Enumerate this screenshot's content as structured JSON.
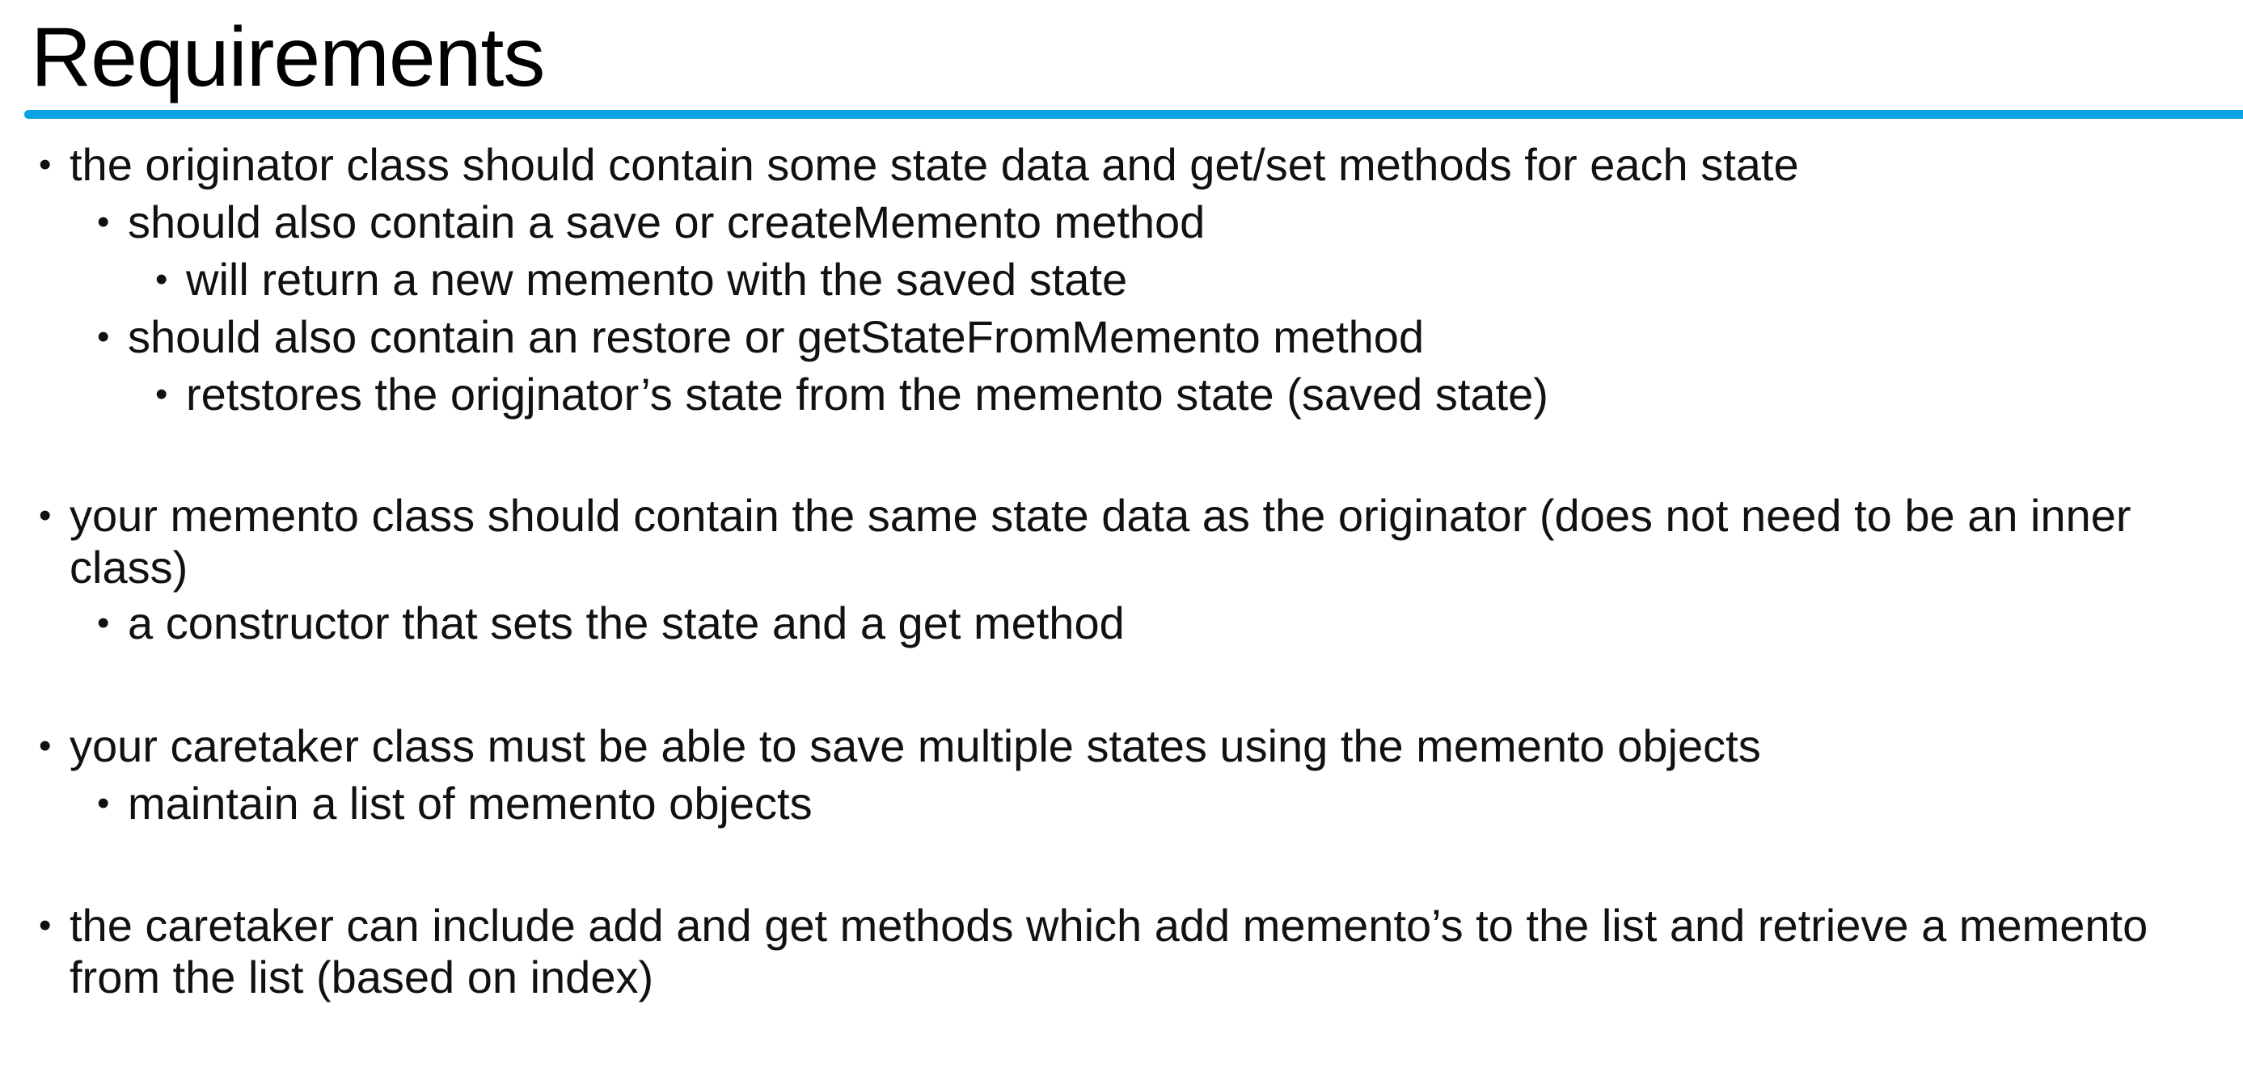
{
  "slide": {
    "title": "Requirements",
    "accent_color": "#0aa3e6",
    "bullets": [
      {
        "text": "the originator class should contain some state data and get/set methods for each state"
      },
      {
        "text": "should also contain a save or createMemento method"
      },
      {
        "text": "will return a new memento with the saved state"
      },
      {
        "text": "should also contain an restore or getStateFromMemento method"
      },
      {
        "text": "retstores the origjnator’s state from the memento state (saved state)"
      },
      {
        "text": "your memento class should contain the same state data as the originator (does not need to be an inner class)"
      },
      {
        "text": "a constructor that sets the state and a get method"
      },
      {
        "text": "your caretaker class must be able to save multiple states using the memento objects"
      },
      {
        "text": "maintain a list of memento objects"
      },
      {
        "text": "the caretaker can include add and get methods which add memento’s to the list and retrieve a memento from the list (based on index)"
      }
    ],
    "bullet_glyph": "•"
  }
}
